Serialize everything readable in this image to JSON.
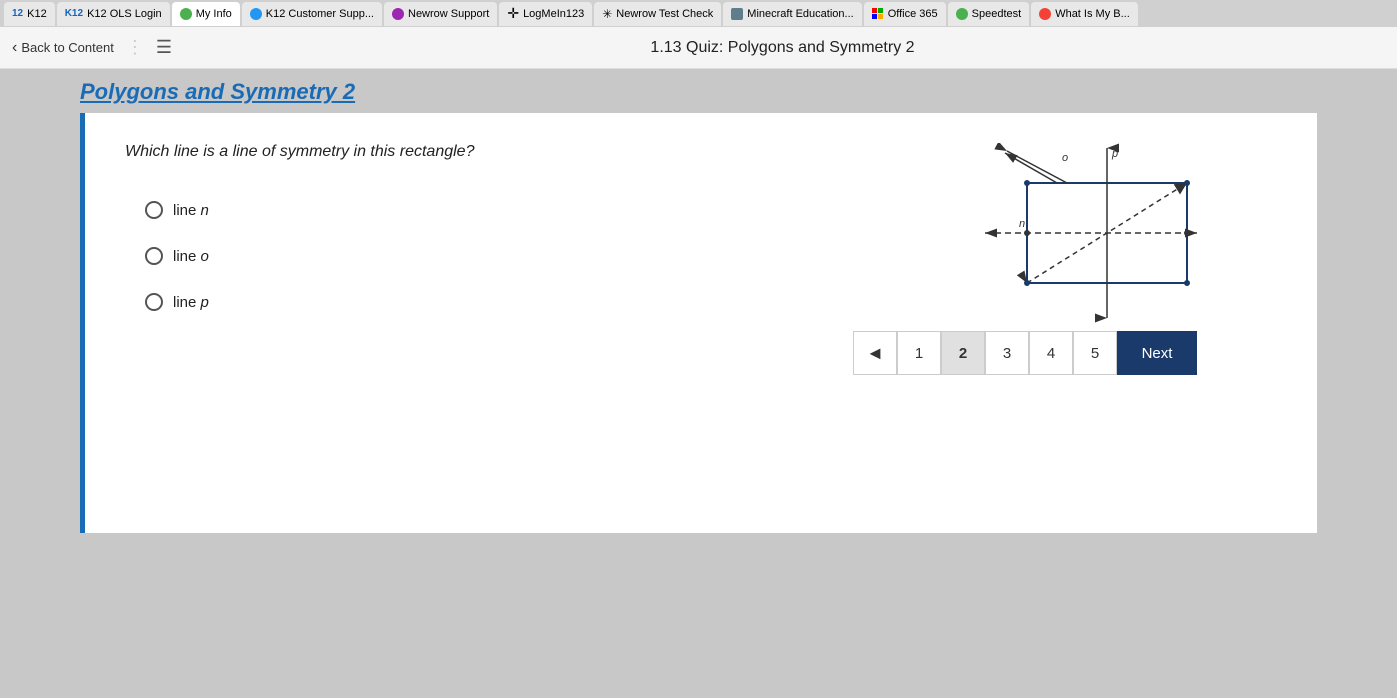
{
  "tabs": [
    {
      "label": "K12",
      "icon": "k12",
      "id": "k12"
    },
    {
      "label": "K12 OLS Login",
      "icon": "k12",
      "id": "ols"
    },
    {
      "label": "My Info",
      "icon": "green",
      "id": "myinfo"
    },
    {
      "label": "K12 Customer Supp...",
      "icon": "blue",
      "id": "support"
    },
    {
      "label": "Newrow Support",
      "icon": "purple",
      "id": "newrow"
    },
    {
      "label": "LogMeIn123",
      "icon": "orange",
      "id": "logmein"
    },
    {
      "label": "Newrow Test Check",
      "icon": "star",
      "id": "newrowtest"
    },
    {
      "label": "Minecraft Education...",
      "icon": "grid",
      "id": "minecraft"
    },
    {
      "label": "Office 365",
      "icon": "grid",
      "id": "office"
    },
    {
      "label": "Speedtest",
      "icon": "speed",
      "id": "speedtest"
    },
    {
      "label": "What Is My B...",
      "icon": "red",
      "id": "whatismy"
    }
  ],
  "nav": {
    "back_label": "Back to Content",
    "title": "1.13 Quiz: Polygons and Symmetry 2"
  },
  "page_heading": "Polygons and Symmetry 2",
  "question": {
    "text": "Which line is a line of symmetry in this rectangle?",
    "options": [
      {
        "id": "n",
        "label": "line n"
      },
      {
        "id": "o",
        "label": "line o"
      },
      {
        "id": "p",
        "label": "line p"
      }
    ]
  },
  "pagination": {
    "prev_label": "◄",
    "pages": [
      "1",
      "2",
      "3",
      "4",
      "5"
    ],
    "active_page": "2",
    "next_label": "Next"
  }
}
